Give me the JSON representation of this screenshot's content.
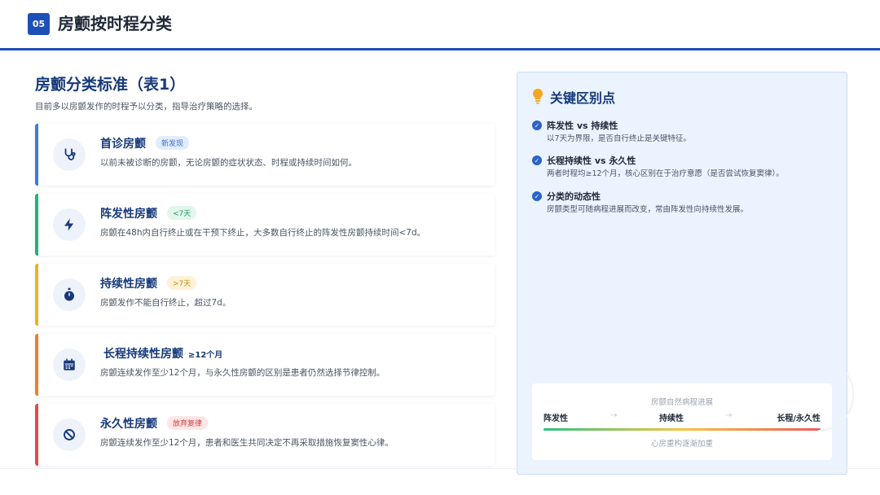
{
  "header": {
    "number": "05",
    "title": "房颤按时程分类"
  },
  "section": {
    "title": "房颤分类标准（表1）",
    "subtitle": "目前多以房颤发作的时程予以分类，指导治疗策略的选择。"
  },
  "cards": [
    {
      "title": "首诊房颤",
      "tag": "新发现",
      "desc": "以前未被诊断的房颤，无论房颤的症状状态、时程或持续时间如何。",
      "color": "#3b7be0",
      "tag_bg": "#e4ecfa",
      "tag_fg": "#3b6fd1",
      "icon": "stethoscope-icon"
    },
    {
      "title": "阵发性房颤",
      "tag": "<7天",
      "desc": "房颤在48h内自行终止或在干预下终止，大多数自行终止的阵发性房颤持续时间<7d。",
      "color": "#22b37a",
      "tag_bg": "#e2f6ec",
      "tag_fg": "#1f9a65",
      "icon": "lightning-icon"
    },
    {
      "title": "持续性房颤",
      "tag": ">7天",
      "desc": "房颤发作不能自行终止，超过7d。",
      "color": "#f2b01e",
      "tag_bg": "#fdf2d6",
      "tag_fg": "#c68a0b",
      "icon": "stopwatch-icon"
    },
    {
      "title": "长程持续性房颤",
      "tag": "≥12个月",
      "desc": "房颤连续发作至少12个月，与永久性房颤的区别是患者仍然选择节律控制。",
      "color": "#f07f2a",
      "tag_bg": "#ffffff",
      "tag_fg": "#173a7a",
      "icon": "calendar-icon"
    },
    {
      "title": "永久性房颤",
      "tag": "放弃复律",
      "desc": "房颤连续发作至少12个月，患者和医生共同决定不再采取措施恢复窦性心律。",
      "color": "#e5484d",
      "tag_bg": "#fde6e6",
      "tag_fg": "#d03d41",
      "icon": "ban-icon"
    }
  ],
  "panel": {
    "title": "关键区别点",
    "points": [
      {
        "heading": "阵发性 vs 持续性",
        "desc": "以7天为界限，是否自行终止是关键特征。"
      },
      {
        "heading": "长程持续性 vs 永久性",
        "desc": "两者时程均≥12个月，核心区别在于治疗意愿（是否尝试恢复窦律）。"
      },
      {
        "heading": "分类的动态性",
        "desc": "房颤类型可随病程进展而改变，常由阵发性向持续性发展。"
      }
    ],
    "progression": {
      "heading": "房颤自然病程进展",
      "stages": [
        "阵发性",
        "持续性",
        "长程/永久性"
      ],
      "footer": "心房重构逐渐加重"
    }
  }
}
